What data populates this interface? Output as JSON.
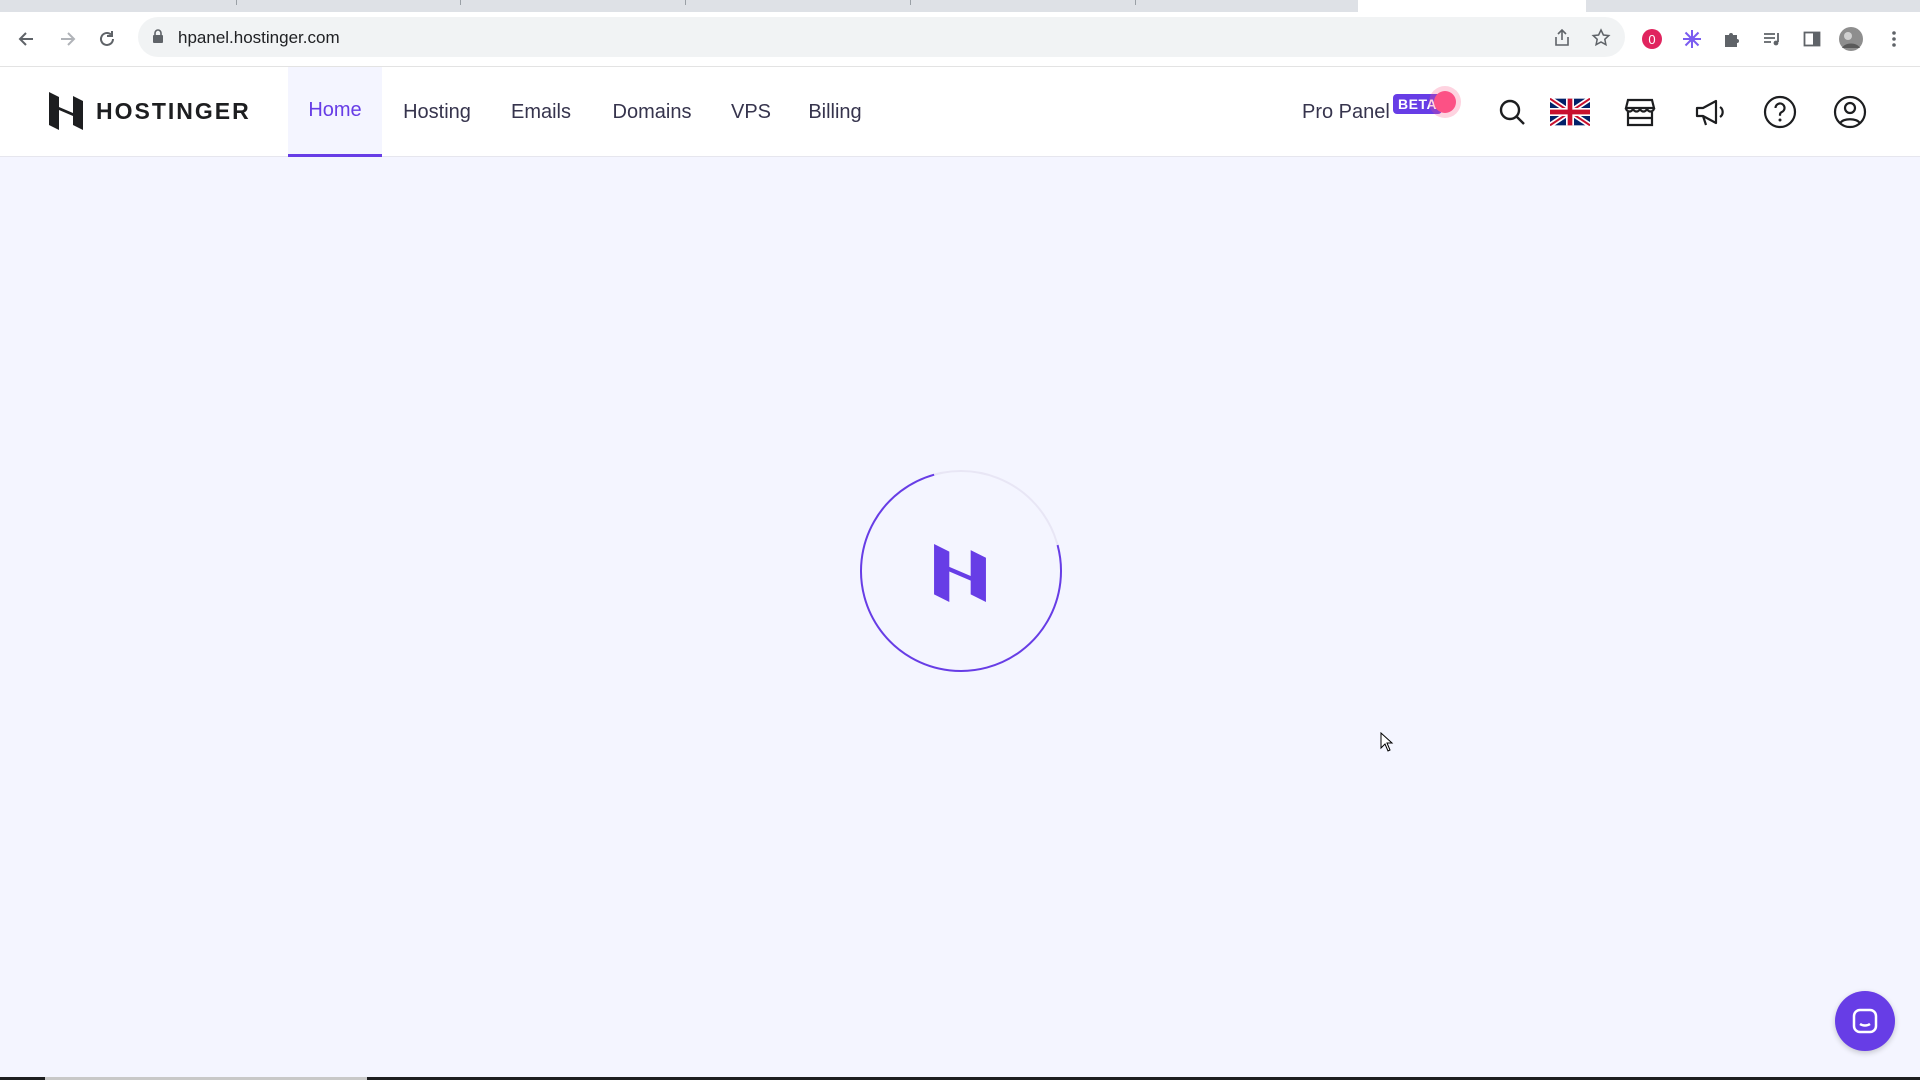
{
  "browser": {
    "url": "hpanel.hostinger.com",
    "extension_badge": "0"
  },
  "header": {
    "logo_text": "HOSTINGER",
    "nav": [
      {
        "label": "Home",
        "active": true
      },
      {
        "label": "Hosting",
        "active": false
      },
      {
        "label": "Emails",
        "active": false
      },
      {
        "label": "Domains",
        "active": false
      },
      {
        "label": "VPS",
        "active": false
      },
      {
        "label": "Billing",
        "active": false
      }
    ],
    "pro_panel_label": "Pro Panel",
    "beta_badge": "BETA",
    "icons": [
      "search-icon",
      "uk-flag-icon",
      "store-icon",
      "megaphone-icon",
      "help-icon",
      "account-icon"
    ]
  },
  "colors": {
    "brand": "#673de6",
    "background": "#f4f5ff",
    "notification": "#fc5185"
  }
}
